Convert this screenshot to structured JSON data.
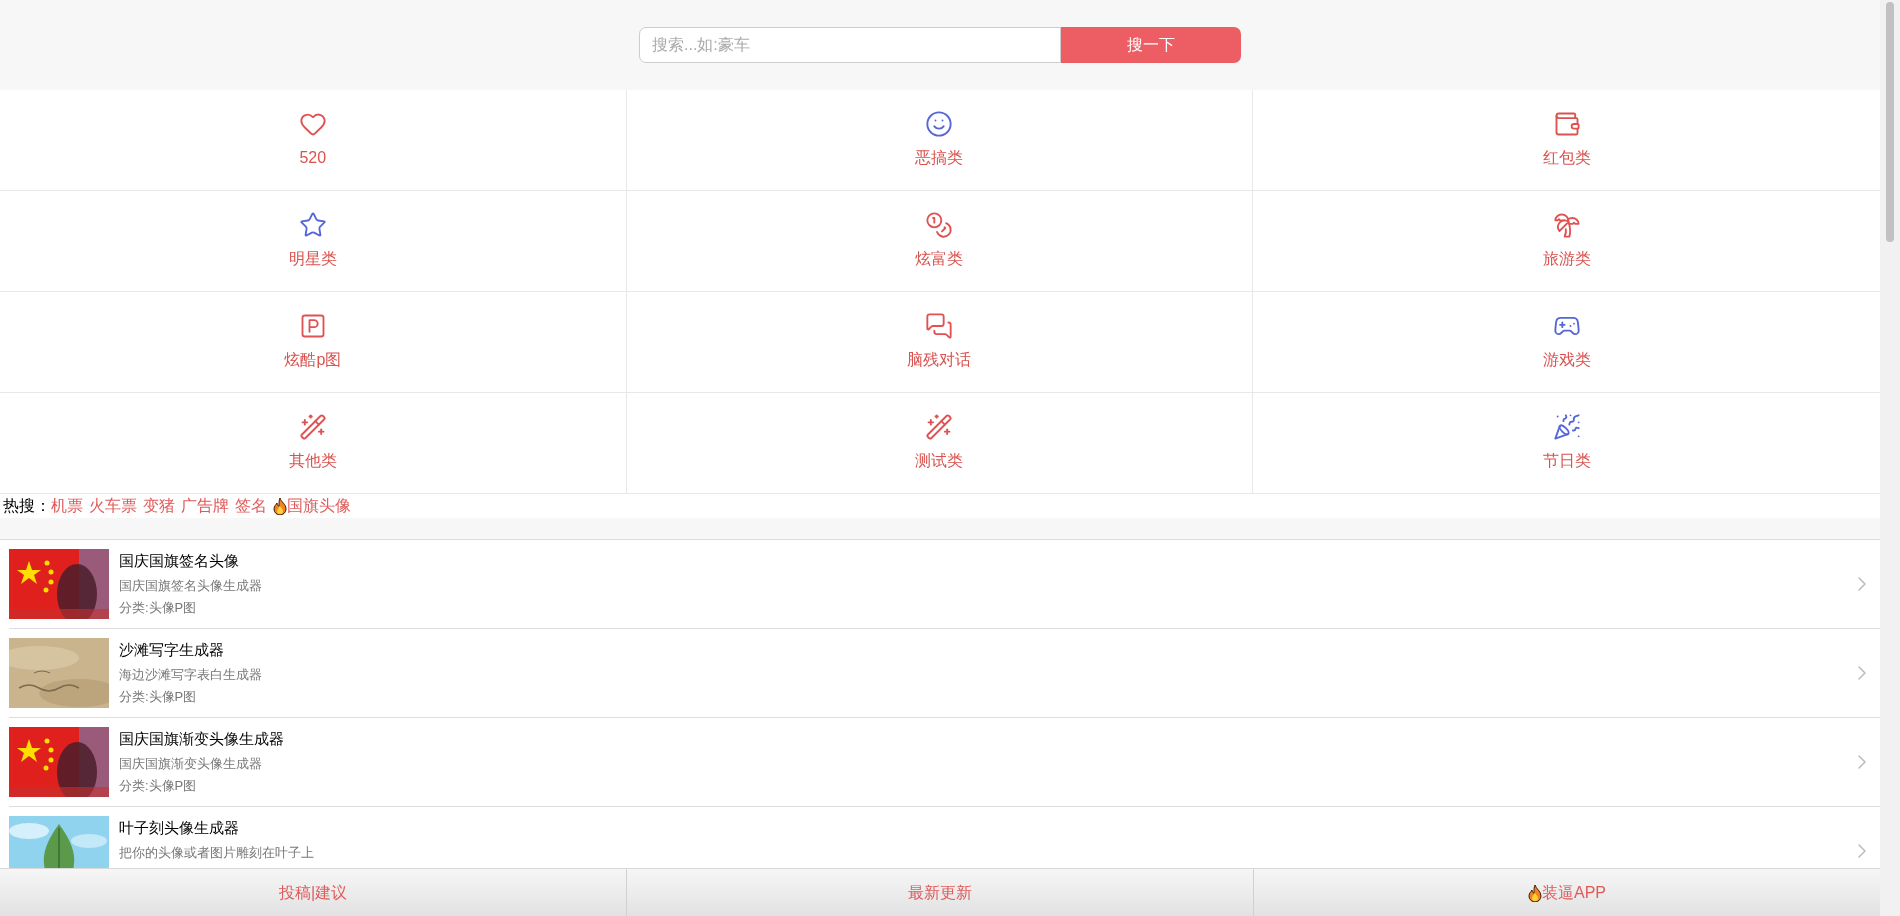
{
  "search": {
    "placeholder": "搜索...如:豪车",
    "button": "搜一下"
  },
  "categories": [
    {
      "label": "520",
      "color": "#e05252"
    },
    {
      "label": "恶搞类",
      "color": "#5566d6"
    },
    {
      "label": "红包类",
      "color": "#d9534f"
    },
    {
      "label": "明星类",
      "color": "#5566d6"
    },
    {
      "label": "炫富类",
      "color": "#e05252"
    },
    {
      "label": "旅游类",
      "color": "#e05252"
    },
    {
      "label": "炫酷p图",
      "color": "#e05252"
    },
    {
      "label": "脑残对话",
      "color": "#e05252"
    },
    {
      "label": "游戏类",
      "color": "#5566d6"
    },
    {
      "label": "其他类",
      "color": "#e05252"
    },
    {
      "label": "测试类",
      "color": "#e05252"
    },
    {
      "label": "节日类",
      "color": "#5566d6"
    }
  ],
  "hot_search": {
    "label": "热搜：",
    "items": [
      {
        "text": "机票",
        "kind": "plain"
      },
      {
        "text": "火车票",
        "kind": "plain"
      },
      {
        "text": "变猪",
        "kind": "plain"
      },
      {
        "text": "广告牌",
        "kind": "plain"
      },
      {
        "text": "签名",
        "kind": "plain"
      },
      {
        "text": "国旗头像",
        "kind": "hot"
      }
    ]
  },
  "list": [
    {
      "title": "国庆国旗签名头像",
      "description": "国庆国旗签名头像生成器",
      "category": "分类:头像P图"
    },
    {
      "title": "沙滩写字生成器",
      "description": "海边沙滩写字表白生成器",
      "category": "分类:头像P图"
    },
    {
      "title": "国庆国旗渐变头像生成器",
      "description": "国庆国旗渐变头像生成器",
      "category": "分类:头像P图"
    },
    {
      "title": "叶子刻头像生成器",
      "description": "把你的头像或者图片雕刻在叶子上"
    }
  ],
  "bottom_bar": [
    {
      "text": "投稿|建议",
      "kind": "plain"
    },
    {
      "text": "最新更新",
      "kind": "plain"
    },
    {
      "text": "装逼APP",
      "kind": "hot"
    }
  ]
}
